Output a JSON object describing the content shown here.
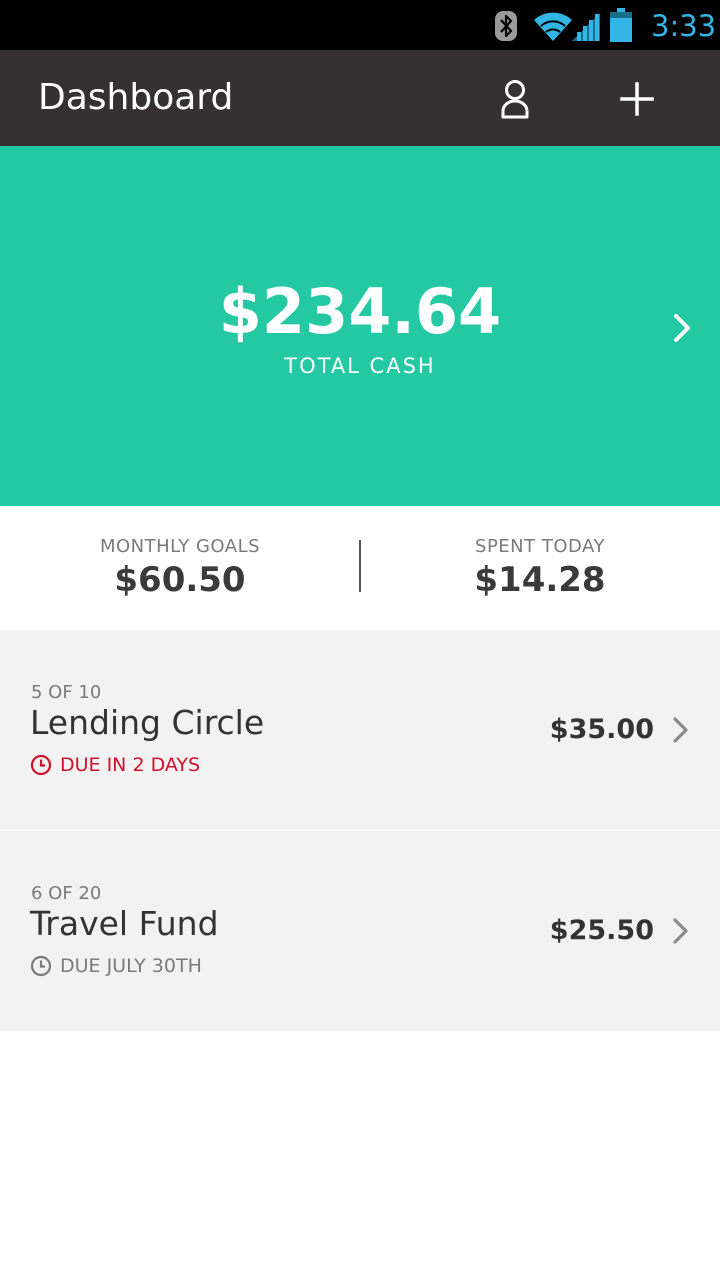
{
  "status_bar": {
    "time": "3:33",
    "icons": [
      "bluetooth-icon",
      "wifi-icon",
      "signal-icon",
      "battery-icon"
    ],
    "accent_color": "#33b5e5"
  },
  "app_bar": {
    "title": "Dashboard",
    "actions": [
      "profile-icon",
      "add-icon"
    ],
    "background": "#353133"
  },
  "summary": {
    "amount": "$234.64",
    "label": "TOTAL CASH",
    "background": "#24c8a2",
    "icon": "chevron-right-icon"
  },
  "stats": {
    "monthly_goals": {
      "label": "MONTHLY GOALS",
      "value": "$60.50"
    },
    "spent_today": {
      "label": "SPENT TODAY",
      "value": "$14.28"
    }
  },
  "goals": [
    {
      "progress": "5 OF 10",
      "title": "Lending Circle",
      "due": "DUE IN 2 DAYS",
      "due_urgent": true,
      "amount": "$35.00",
      "icon": "clock-icon"
    },
    {
      "progress": "6 OF 20",
      "title": "Travel Fund",
      "due": "DUE JULY 30TH",
      "due_urgent": false,
      "amount": "$25.50",
      "icon": "clock-icon"
    }
  ],
  "colors": {
    "urgent": "#d0112b",
    "muted": "#7a7a7a",
    "row_background": "#f2f2f2"
  }
}
